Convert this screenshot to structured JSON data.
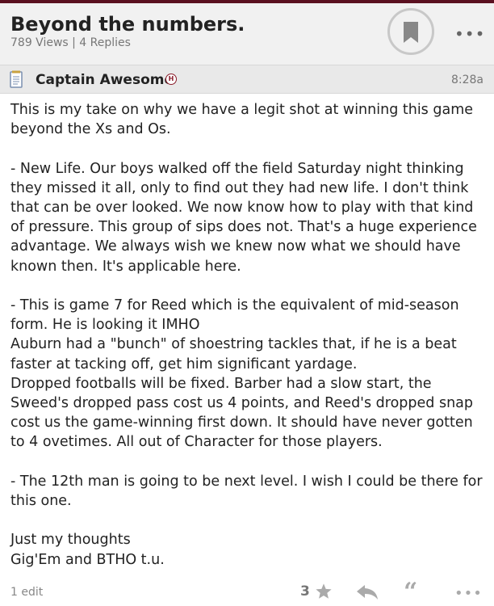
{
  "thread": {
    "title": "Beyond the numbers.",
    "meta": "789 Views | 4 Replies"
  },
  "post": {
    "author": "Captain Awesome",
    "rank_badge": "H",
    "time": "8:28a",
    "paragraphs": [
      [
        "This is my take on why we have a legit shot at winning this game beyond the Xs and Os."
      ],
      [
        "- New Life. Our boys walked off the field Saturday night thinking they missed it all, only to find out they had new life. I don't think that can be over looked. We now know how to play with that kind of pressure. This group of sips does not. That's a huge experience advantage. We always wish we knew now what we should have known then. It's applicable here."
      ],
      [
        "- This is game 7 for Reed which is the equivalent of mid-season form. He is looking it IMHO",
        "Auburn had a \"bunch\" of shoestring tackles that, if he is a beat faster at tacking off, get him significant yardage.",
        "Dropped footballs will be fixed. Barber had a slow start, the Sweed's dropped pass cost us 4 points, and Reed's dropped snap cost us the game-winning first down. It should have never gotten to 4 ovetimes. All out of Character for those players."
      ],
      [
        "- The 12th man is going to be next level. I wish I could be there for this one."
      ],
      [
        "Just my thoughts",
        "Gig'Em and BTHO t.u."
      ]
    ]
  },
  "footer": {
    "edit_count": "1 edit",
    "star_count": "3"
  },
  "icons": {
    "bookmark": "bookmark-icon",
    "more": "more-icon",
    "notepad": "notepad-icon",
    "star": "star-icon",
    "reply": "reply-icon",
    "quote": "quote-icon"
  },
  "colors": {
    "brand_maroon": "#5a1020",
    "badge": "#8a1c2a"
  }
}
